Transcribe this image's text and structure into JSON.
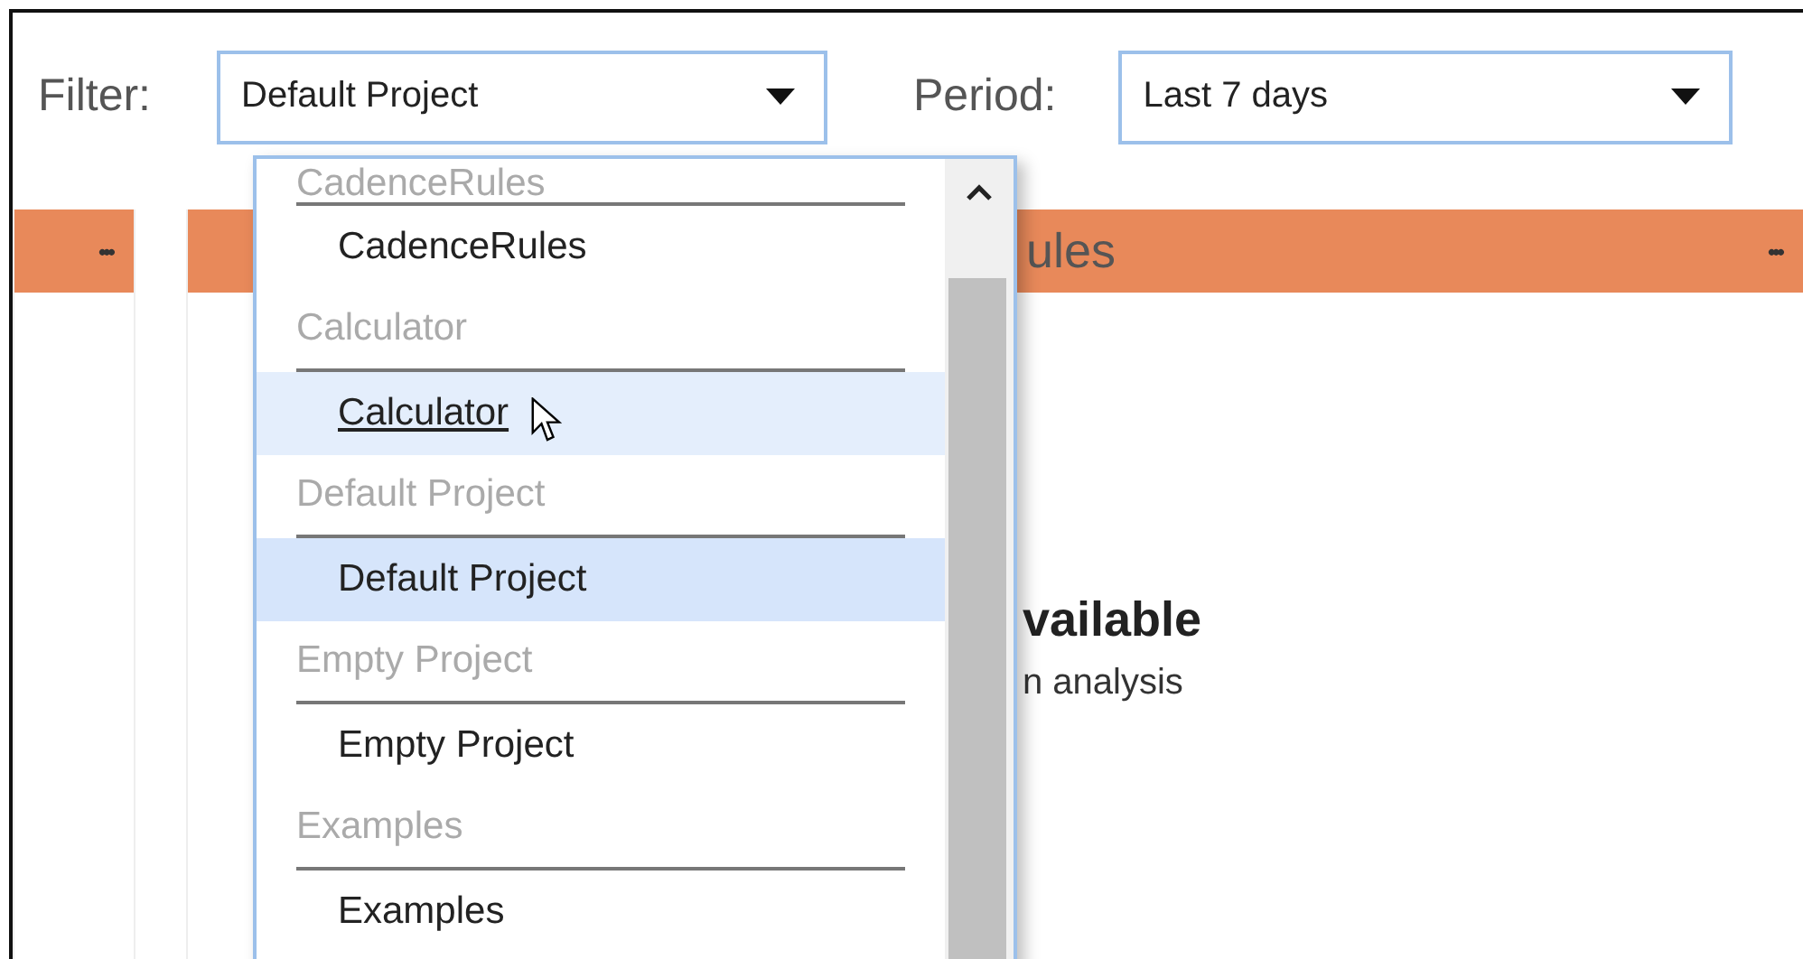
{
  "filter": {
    "label": "Filter:",
    "value": "Default Project"
  },
  "period": {
    "label": "Period:",
    "value": "Last 7 days"
  },
  "side_panel": {
    "menu": "•••"
  },
  "main_panel": {
    "title": "ules",
    "menu": "•••",
    "message": "vailable",
    "hint": "n analysis"
  },
  "dropdown": {
    "groups": [
      {
        "header": "CadenceRules",
        "items": [
          {
            "label": "CadenceRules",
            "selected": false,
            "hovered": false
          }
        ]
      },
      {
        "header": "Calculator",
        "items": [
          {
            "label": "Calculator",
            "selected": false,
            "hovered": true
          }
        ]
      },
      {
        "header": "Default Project",
        "items": [
          {
            "label": "Default Project",
            "selected": true,
            "hovered": false
          }
        ]
      },
      {
        "header": "Empty Project",
        "items": [
          {
            "label": "Empty Project",
            "selected": false,
            "hovered": false
          }
        ]
      },
      {
        "header": "Examples",
        "items": [
          {
            "label": "Examples",
            "selected": false,
            "hovered": false
          }
        ]
      }
    ]
  }
}
